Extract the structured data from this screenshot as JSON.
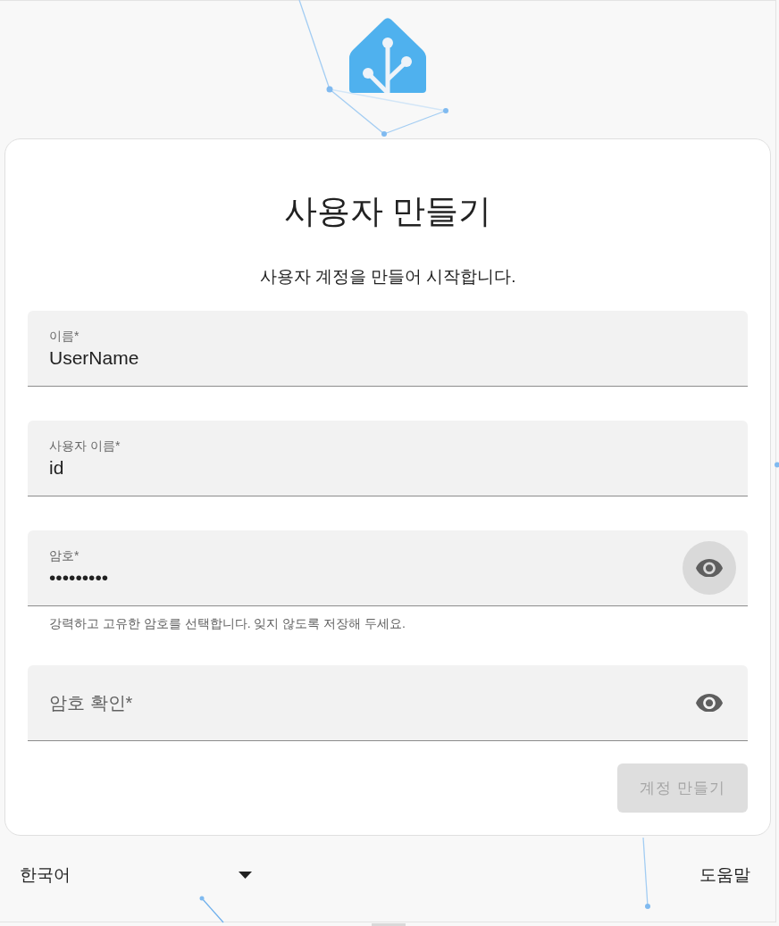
{
  "card": {
    "title": "사용자 만들기",
    "subtitle": "사용자 계정을 만들어 시작합니다.",
    "fields": [
      {
        "kind": "text",
        "label": "이름*",
        "value": "UserName"
      },
      {
        "kind": "text",
        "label": "사용자 이름*",
        "value": "id"
      },
      {
        "kind": "password",
        "label": "암호*",
        "value": "•••••••••",
        "helper": "강력하고 고유한 암호를 선택합니다. 잊지 않도록 저장해 두세요.",
        "toggle_highlighted": true
      },
      {
        "kind": "password",
        "label": "암호 확인*",
        "toggle_highlighted": false
      }
    ],
    "submit": {
      "label": "계정 만들기",
      "disabled": true
    }
  },
  "footer": {
    "language": "한국어",
    "help": "도움말"
  }
}
